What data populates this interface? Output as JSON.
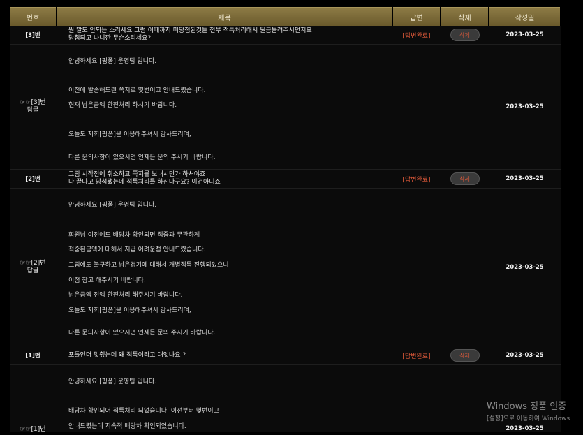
{
  "headers": {
    "no": "번호",
    "title": "제목",
    "answer": "답변",
    "delete": "삭제",
    "date": "작성일"
  },
  "posts": [
    {
      "num": "[3]번",
      "title_lines": [
        "뭔 말도 안되는 소리세요 그럼 이때까지 미당첨된것들 전부 적특처리해서 원금돌려주시던지요",
        "당첨되고 나니깐 무슨소리세요?"
      ],
      "status": "[답변완료]",
      "delete": "삭제",
      "date": "2023-03-25",
      "answer_label": [
        "☞☞[3]번",
        "답글"
      ],
      "answer_date": "2023-03-25",
      "answer_lines": [
        "안녕하세요 [핑퐁] 운영팀 입니다.",
        "이전에 발송해드린 쪽지로 몇번이고 안내드렸습니다.",
        "현재 남은금액 환전처리 하시기 바랍니다.",
        "오늘도 저희[핑퐁]을 이용해주셔서 감사드리며,",
        "다른 문의사항이 있으시면 언제든 문의 주시기 바랍니다."
      ]
    },
    {
      "num": "[2]번",
      "title_lines": [
        "그럼 시작전에 취소하고 쪽지를 보내시던가 하셔야죠",
        "다 끝나고 당첨됐는데 적특처리를 하신다구요? 이건아니죠"
      ],
      "status": "[답변완료]",
      "delete": "삭제",
      "date": "2023-03-25",
      "answer_label": [
        "☞☞[2]번",
        "답글"
      ],
      "answer_date": "2023-03-25",
      "answer_lines": [
        "안녕하세요 [핑퐁] 운영팀 입니다.",
        "회원님 이전에도 배당차 확인되면 적중과 무관하게",
        "적중된금액에 대해서 지급 어려운점 안내드렸습니다.",
        "그럼에도 불구하고 남은경기에 대해서 개별적특 진행되었으니",
        "이점 참고 해주시기 바랍니다.",
        "남은금액 전액 환전처리 해주시기 바랍니다.",
        "오늘도 저희[핑퐁]을 이용해주셔서 감사드리며,",
        "다른 문의사항이 있으시면 언제든 문의 주시기 바랍니다."
      ]
    },
    {
      "num": "[1]번",
      "title_lines": [
        "포틀언더 맞췄는데 왜 적특이라고 대잇나요 ?"
      ],
      "status": "[답변완료]",
      "delete": "삭제",
      "date": "2023-03-25",
      "answer_label": [
        "☞☞[1]번"
      ],
      "answer_date": "2023-03-25",
      "answer_lines": [
        "안녕하세요 [핑퐁] 운영팀 입니다.",
        "배당차 확인되어 적특처리 되었습니다. 이전부터 몇번이고",
        "안내드렸는데 지속적 배당차 확인되었습니다."
      ]
    }
  ],
  "watermark": {
    "line1": "Windows 정품 인증",
    "line2": "[설정]으로 이동하여 Windows"
  }
}
